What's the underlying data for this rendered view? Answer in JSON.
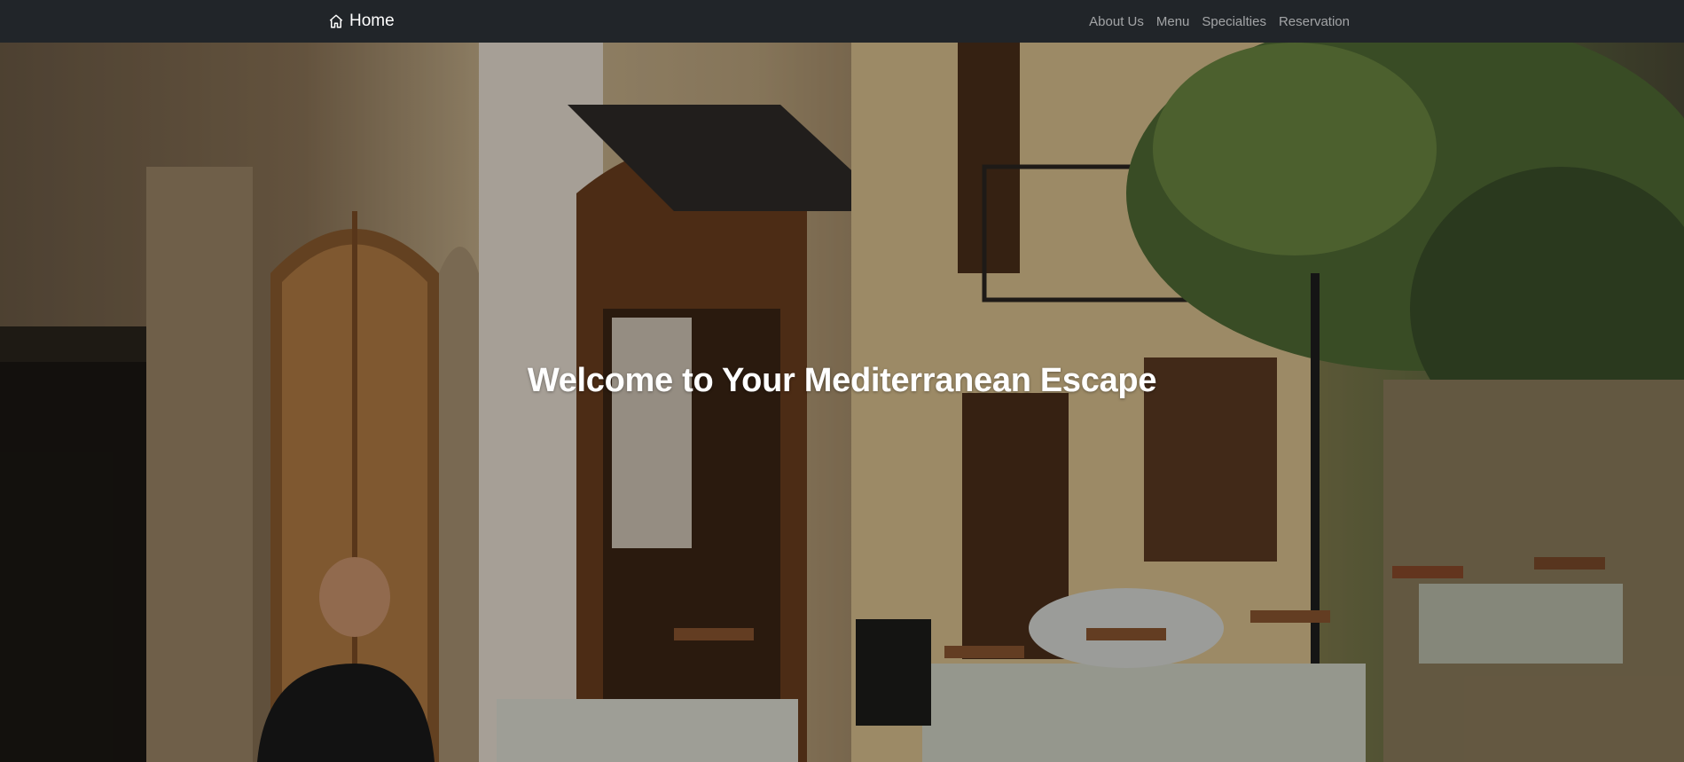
{
  "navbar": {
    "brand_label": "Home",
    "brand_icon": "house-icon",
    "links": [
      {
        "label": "About Us"
      },
      {
        "label": "Menu"
      },
      {
        "label": "Specialties"
      },
      {
        "label": "Reservation"
      }
    ]
  },
  "hero": {
    "title": "Welcome to Your Mediterranean Escape",
    "background_image": "mediterranean-taverna-courtyard"
  },
  "colors": {
    "navbar_bg": "#212529",
    "nav_link": "rgba(255,255,255,0.58)",
    "title": "#ffffff"
  }
}
